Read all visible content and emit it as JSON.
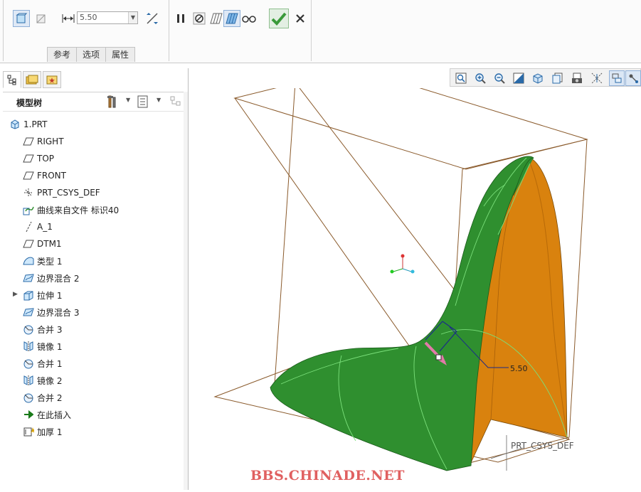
{
  "ribbon": {
    "thickness_value": "5.50",
    "tabs": [
      "参考",
      "选项",
      "属性"
    ]
  },
  "model_tree": {
    "title": "模型树",
    "items": [
      {
        "label": "1.PRT",
        "icon": "part-icon",
        "indent": 0
      },
      {
        "label": "RIGHT",
        "icon": "datum-plane-icon",
        "indent": 1
      },
      {
        "label": "TOP",
        "icon": "datum-plane-icon",
        "indent": 1
      },
      {
        "label": "FRONT",
        "icon": "datum-plane-icon",
        "indent": 1
      },
      {
        "label": "PRT_CSYS_DEF",
        "icon": "csys-icon",
        "indent": 1
      },
      {
        "label": "曲线来自文件 标识40",
        "icon": "curve-from-file-icon",
        "indent": 1
      },
      {
        "label": "A_1",
        "icon": "datum-axis-icon",
        "indent": 1
      },
      {
        "label": "DTM1",
        "icon": "datum-plane-icon",
        "indent": 1
      },
      {
        "label": "类型 1",
        "icon": "style-surface-icon",
        "indent": 1
      },
      {
        "label": "边界混合 2",
        "icon": "boundary-blend-icon",
        "indent": 1
      },
      {
        "label": "拉伸 1",
        "icon": "extrude-icon",
        "indent": 1,
        "expandable": true
      },
      {
        "label": "边界混合 3",
        "icon": "boundary-blend-icon",
        "indent": 1
      },
      {
        "label": "合并 3",
        "icon": "merge-icon",
        "indent": 1
      },
      {
        "label": "镜像 1",
        "icon": "mirror-icon",
        "indent": 1
      },
      {
        "label": "合并 1",
        "icon": "merge-icon",
        "indent": 1
      },
      {
        "label": "镜像 2",
        "icon": "mirror-icon",
        "indent": 1
      },
      {
        "label": "合并 2",
        "icon": "merge-icon",
        "indent": 1
      },
      {
        "label": "在此插入",
        "icon": "insert-here-arrow-icon",
        "indent": 1
      },
      {
        "label": "加厚 1",
        "icon": "thicken-icon",
        "indent": 1
      }
    ]
  },
  "viewport": {
    "dimension_label": "5.50",
    "csys_label": "PRT_CSYS_DEF"
  },
  "watermark": "BBS.CHINADE.NET",
  "colors": {
    "surface_green": "#2f8f2f",
    "surface_orange": "#d9820e",
    "datum_plane": "#8a5a2b",
    "accept_green": "#3a9a3a"
  }
}
